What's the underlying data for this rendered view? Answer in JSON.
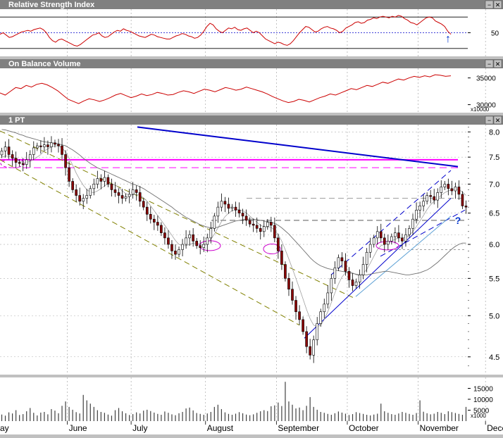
{
  "panels": {
    "rsi": {
      "title": "Relative Strength Index"
    },
    "obv": {
      "title": "On Balance Volume"
    },
    "price": {
      "title": "1 PT"
    }
  },
  "window_buttons": [
    "−",
    "✕"
  ],
  "annotations": {
    "question_mark": "?",
    "up_arrow": "↑"
  },
  "colors": {
    "panel_bg": "#ffffff",
    "titlebar": "#808080",
    "rsi_line": "#cc0000",
    "obv_line": "#cc0000",
    "up_candle": "#ffffff",
    "down_candle": "#8b0000",
    "resistance": "#ff00ff",
    "trendline": "#0000cc",
    "channel": "#808000",
    "ma": "#808080",
    "blue_channel": "#0000cc",
    "ellipse": "#cc00cc"
  },
  "chart_data": [
    {
      "type": "line",
      "panel": "rsi",
      "title": "Relative Strength Index",
      "y_ticks": [
        "50"
      ],
      "y_ticks_values": [
        50
      ],
      "ylim": [
        20,
        80
      ],
      "reference_lines": [
        70,
        50,
        30
      ],
      "series": [
        {
          "values": [
            48,
            50,
            47,
            44,
            45,
            47,
            49,
            51,
            52,
            53,
            52,
            54,
            55,
            56,
            54,
            50,
            44,
            40,
            38,
            41,
            42,
            40,
            38,
            36,
            34,
            33,
            35,
            38,
            41,
            44,
            47,
            48,
            50,
            46,
            44,
            45,
            48,
            51,
            53,
            52,
            55,
            53,
            52,
            50,
            48,
            46,
            45,
            44,
            46,
            48,
            47,
            45,
            44,
            43,
            42,
            42,
            44,
            46,
            47,
            49,
            48,
            46,
            45,
            43,
            44,
            47,
            52,
            58,
            62,
            60,
            55,
            52,
            50,
            53,
            56,
            55,
            57,
            54,
            53,
            55,
            56,
            53,
            50,
            52,
            50,
            46,
            42,
            40,
            38,
            36,
            38,
            37,
            35,
            34,
            36,
            40,
            45,
            50,
            54,
            58,
            57,
            54,
            51,
            52,
            55,
            57,
            58,
            56,
            55,
            53,
            50,
            52,
            56,
            58,
            60,
            63,
            64,
            62,
            63,
            66,
            67,
            69,
            68,
            70,
            71,
            70,
            69,
            71,
            70,
            72,
            71,
            68,
            66,
            63,
            62,
            60,
            63,
            66,
            69,
            70,
            69,
            65,
            63,
            61,
            58,
            52,
            48
          ]
        }
      ]
    },
    {
      "type": "line",
      "panel": "obv",
      "title": "On Balance Volume",
      "y_ticks": [
        "35000",
        "30000"
      ],
      "y_ticks_values": [
        35000,
        30000
      ],
      "unit_note": "x10000",
      "ylim": [
        28500,
        36800
      ],
      "series": [
        {
          "values": [
            32200,
            31800,
            32500,
            33200,
            33000,
            33600,
            33300,
            33800,
            34000,
            33700,
            33200,
            32600,
            31800,
            31000,
            30600,
            30200,
            30700,
            31100,
            30900,
            30600,
            30900,
            31300,
            31800,
            32100,
            31700,
            31300,
            31600,
            32000,
            31700,
            31900,
            32300,
            32100,
            31800,
            31900,
            32300,
            32600,
            32400,
            32100,
            32500,
            32900,
            32700,
            32400,
            32800,
            33200,
            33000,
            32700,
            32900,
            33300,
            33000,
            32700,
            32400,
            32000,
            31500,
            31100,
            30700,
            30400,
            30600,
            31000,
            30800,
            30500,
            30900,
            31300,
            31600,
            32000,
            31800,
            32200,
            32600,
            33000,
            32800,
            33200,
            33600,
            33400,
            33800,
            34200,
            34000,
            34400,
            34800,
            34600,
            35000,
            35300,
            35100,
            35400,
            35200,
            35600,
            35500,
            35300,
            35400
          ]
        }
      ]
    },
    {
      "type": "candlestick",
      "panel": "price",
      "title": "1 PT",
      "y_ticks": [
        "8.0",
        "7.5",
        "7.0",
        "6.5",
        "6.0",
        "5.5",
        "5.0",
        "4.5"
      ],
      "y_ticks_values": [
        8.0,
        7.5,
        7.0,
        6.5,
        6.0,
        5.5,
        5.0,
        4.5
      ],
      "ylim": [
        4.3,
        8.15
      ],
      "scale": "log",
      "x_labels": [
        "ay",
        "June",
        "July",
        "August",
        "September",
        "October",
        "November",
        "December"
      ],
      "x_label_positions": [
        0,
        19,
        37,
        58,
        78,
        98,
        118,
        137
      ],
      "closes": [
        7.62,
        7.7,
        7.55,
        7.48,
        7.4,
        7.38,
        7.36,
        7.45,
        7.55,
        7.68,
        7.72,
        7.7,
        7.74,
        7.7,
        7.78,
        7.75,
        7.72,
        7.55,
        7.3,
        7.05,
        6.9,
        6.8,
        6.7,
        6.75,
        6.8,
        6.92,
        7.0,
        7.1,
        7.05,
        7.12,
        7.0,
        6.9,
        6.85,
        6.8,
        6.75,
        6.78,
        6.82,
        6.9,
        6.85,
        6.7,
        6.6,
        6.48,
        6.4,
        6.35,
        6.3,
        6.18,
        6.1,
        6.0,
        5.9,
        5.85,
        5.92,
        6.0,
        6.1,
        6.15,
        6.05,
        5.98,
        5.95,
        6.0,
        6.1,
        6.25,
        6.45,
        6.6,
        6.7,
        6.65,
        6.58,
        6.6,
        6.55,
        6.5,
        6.45,
        6.38,
        6.32,
        6.3,
        6.25,
        6.2,
        6.28,
        6.35,
        6.3,
        6.1,
        5.9,
        5.7,
        5.5,
        5.35,
        5.2,
        5.05,
        4.95,
        4.8,
        4.62,
        4.52,
        4.7,
        4.9,
        5.05,
        5.15,
        5.3,
        5.5,
        5.65,
        5.8,
        5.75,
        5.6,
        5.48,
        5.4,
        5.45,
        5.55,
        5.7,
        5.88,
        6.0,
        6.1,
        6.2,
        6.1,
        6.0,
        6.05,
        6.12,
        6.18,
        6.1,
        6.05,
        6.15,
        6.25,
        6.4,
        6.55,
        6.62,
        6.7,
        6.8,
        6.78,
        6.72,
        6.85,
        6.95,
        7.0,
        6.92,
        6.88,
        6.95,
        6.82,
        6.62,
        6.6
      ],
      "ma_short": [
        7.5,
        7.52,
        7.52,
        7.5,
        7.46,
        7.42,
        7.4,
        7.4,
        7.42,
        7.45,
        7.5,
        7.55,
        7.62,
        7.66,
        7.7,
        7.72,
        7.72,
        7.68,
        7.6,
        7.48,
        7.35,
        7.2,
        7.08,
        6.98,
        6.9,
        6.86,
        6.85,
        6.88,
        6.92,
        6.97,
        7.0,
        7.0,
        6.98,
        6.94,
        6.88,
        6.83,
        6.81,
        6.81,
        6.82,
        6.8,
        6.76,
        6.7,
        6.62,
        6.54,
        6.46,
        6.38,
        6.3,
        6.22,
        6.14,
        6.06,
        6.0,
        5.98,
        5.98,
        6.0,
        6.02,
        6.02,
        6.0,
        5.99,
        6.02,
        6.08,
        6.16,
        6.26,
        6.36,
        6.44,
        6.5,
        6.54,
        6.56,
        6.56,
        6.54,
        6.5,
        6.45,
        6.4,
        6.35,
        6.3,
        6.28,
        6.27,
        6.27,
        6.22,
        6.15,
        6.05,
        5.92,
        5.78,
        5.64,
        5.5,
        5.36,
        5.22,
        5.08,
        4.96,
        4.88,
        4.86,
        4.88,
        4.95,
        5.05,
        5.17,
        5.3,
        5.42,
        5.52,
        5.58,
        5.6,
        5.58,
        5.55,
        5.54,
        5.57,
        5.63,
        5.72,
        5.82,
        5.92,
        5.98,
        6.0,
        6.02,
        6.05,
        6.08,
        6.1,
        6.1,
        6.11,
        6.14,
        6.2,
        6.28,
        6.37,
        6.46,
        6.56,
        6.64,
        6.7,
        6.75,
        6.8,
        6.85,
        6.88,
        6.9,
        6.91,
        6.9,
        6.86,
        6.8
      ],
      "ma_long": [
        8.05,
        8.04,
        8.02,
        8.0,
        7.98,
        7.95,
        7.93,
        7.9,
        7.88,
        7.86,
        7.84,
        7.82,
        7.8,
        7.79,
        7.78,
        7.77,
        7.76,
        7.74,
        7.72,
        7.68,
        7.64,
        7.59,
        7.54,
        7.48,
        7.43,
        7.38,
        7.34,
        7.3,
        7.27,
        7.24,
        7.21,
        7.18,
        7.15,
        7.12,
        7.09,
        7.06,
        7.03,
        7.0,
        6.98,
        6.95,
        6.92,
        6.88,
        6.84,
        6.8,
        6.76,
        6.72,
        6.68,
        6.64,
        6.6,
        6.55,
        6.51,
        6.47,
        6.43,
        6.4,
        6.37,
        6.34,
        6.31,
        6.29,
        6.27,
        6.26,
        6.26,
        6.27,
        6.29,
        6.31,
        6.33,
        6.35,
        6.37,
        6.38,
        6.39,
        6.4,
        6.4,
        6.4,
        6.39,
        6.38,
        6.37,
        6.36,
        6.35,
        6.33,
        6.3,
        6.26,
        6.21,
        6.16,
        6.1,
        6.04,
        5.98,
        5.92,
        5.86,
        5.8,
        5.75,
        5.71,
        5.68,
        5.66,
        5.64,
        5.63,
        5.62,
        5.61,
        5.6,
        5.59,
        5.58,
        5.57,
        5.56,
        5.55,
        5.55,
        5.55,
        5.56,
        5.57,
        5.58,
        5.59,
        5.6,
        5.6,
        5.59,
        5.58,
        5.57,
        5.56,
        5.55,
        5.55,
        5.56,
        5.57,
        5.58,
        5.6,
        5.62,
        5.65,
        5.69,
        5.73,
        5.78,
        5.83,
        5.88,
        5.93,
        5.97,
        6.0,
        6.02,
        6.02
      ],
      "levels": {
        "solid_magenta": 7.45,
        "dashed_magenta": 7.3,
        "dashed_gray_1": 6.75,
        "dashed_gray_2": 6.38,
        "dashed_gray_3": 5.92,
        "dashed_gray_4": 6.15
      }
    },
    {
      "type": "bar",
      "panel": "volume",
      "y_ticks": [
        "15000",
        "10000",
        "5000"
      ],
      "y_ticks_values": [
        15000,
        10000,
        5000
      ],
      "unit_note": "x1000",
      "ylim": [
        0,
        20000
      ],
      "values": [
        3000,
        2500,
        4000,
        3500,
        5000,
        2800,
        3200,
        4500,
        6000,
        3800,
        2600,
        3900,
        4200,
        3100,
        5500,
        4800,
        3600,
        7000,
        9000,
        6500,
        5200,
        4100,
        3500,
        12000,
        9500,
        8000,
        6500,
        5000,
        4200,
        3800,
        3000,
        2500,
        5000,
        6000,
        4500,
        3600,
        2800,
        3200,
        4000,
        3500,
        4800,
        5200,
        4600,
        3900,
        3300,
        2900,
        4400,
        3800,
        3100,
        2700,
        3600,
        4200,
        5800,
        6200,
        4900,
        3700,
        3300,
        2900,
        3500,
        4200,
        6500,
        7500,
        5500,
        4000,
        3300,
        2900,
        3400,
        4100,
        3600,
        3000,
        2700,
        3100,
        3800,
        4500,
        5000,
        4600,
        6800,
        7200,
        8500,
        6900,
        18000,
        9000,
        7500,
        5800,
        6200,
        5000,
        7000,
        11000,
        6500,
        5200,
        4200,
        3800,
        3300,
        2900,
        3600,
        4400,
        3900,
        3400,
        2800,
        3200,
        4100,
        3700,
        3300,
        2900,
        2600,
        3000,
        3400,
        8000,
        4500,
        3800,
        3200,
        2900,
        3500,
        4200,
        3800,
        3300,
        2900,
        3700,
        9500,
        4300,
        3600,
        3100,
        3400,
        4200,
        3800,
        3200,
        4500,
        4100,
        3700,
        3300,
        2900,
        6500,
        4800,
        3900
      ]
    }
  ]
}
